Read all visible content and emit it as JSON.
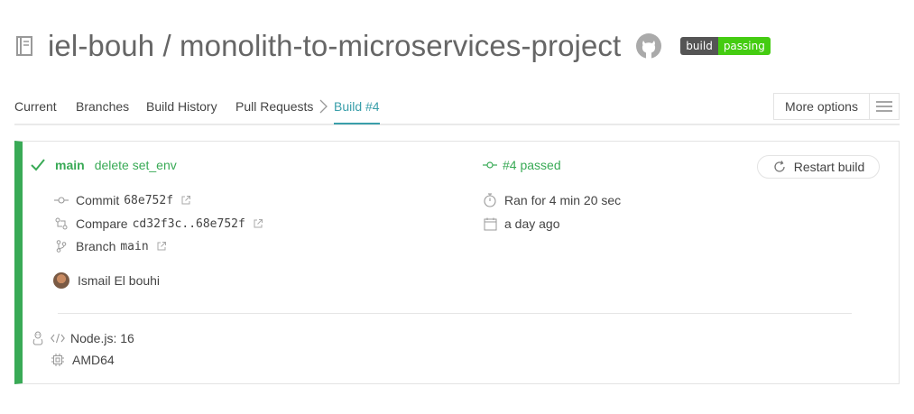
{
  "header": {
    "title": "iel-bouh / monolith-to-microservices-project",
    "badge_left": "build",
    "badge_right": "passing"
  },
  "tabs": {
    "current": "Current",
    "branches": "Branches",
    "build_history": "Build History",
    "pull_requests": "Pull Requests",
    "build": "Build #4",
    "more_options": "More options"
  },
  "build": {
    "branch": "main",
    "message": "delete set_env",
    "status": "#4 passed",
    "restart_label": "Restart build",
    "commit_label": "Commit",
    "commit_hash": "68e752f",
    "compare_label": "Compare",
    "compare_range": "cd32f3c..68e752f",
    "branch_label": "Branch",
    "branch_name": "main",
    "duration": "Ran for 4 min 20 sec",
    "when": "a day ago",
    "author": "Ismail El bouhi",
    "language": "Node.js: 16",
    "arch": "AMD64"
  },
  "colors": {
    "passed": "#39aa56",
    "accent": "#3a9faa",
    "badge_green": "#44cc11"
  }
}
